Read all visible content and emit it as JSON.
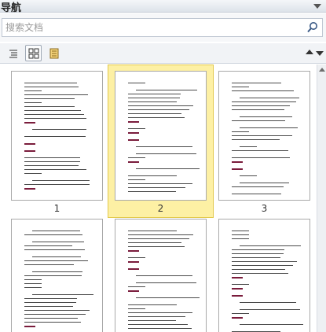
{
  "panel": {
    "title": "导航"
  },
  "search": {
    "placeholder": "搜索文档"
  },
  "toolbar": {
    "buttons": [
      {
        "name": "headings-view-button",
        "icon": "outline-list-icon"
      },
      {
        "name": "pages-view-button",
        "icon": "thumbnails-grid-icon",
        "active": true
      },
      {
        "name": "results-view-button",
        "icon": "document-page-icon"
      }
    ]
  },
  "thumbnails": [
    {
      "label": "1",
      "selected": false
    },
    {
      "label": "2",
      "selected": true
    },
    {
      "label": "3",
      "selected": false
    },
    {
      "label": "",
      "selected": false
    },
    {
      "label": "",
      "selected": false
    },
    {
      "label": "",
      "selected": false
    }
  ],
  "colors": {
    "selection": "#fdf0a4",
    "heading_mark": "#7a1c3c"
  }
}
